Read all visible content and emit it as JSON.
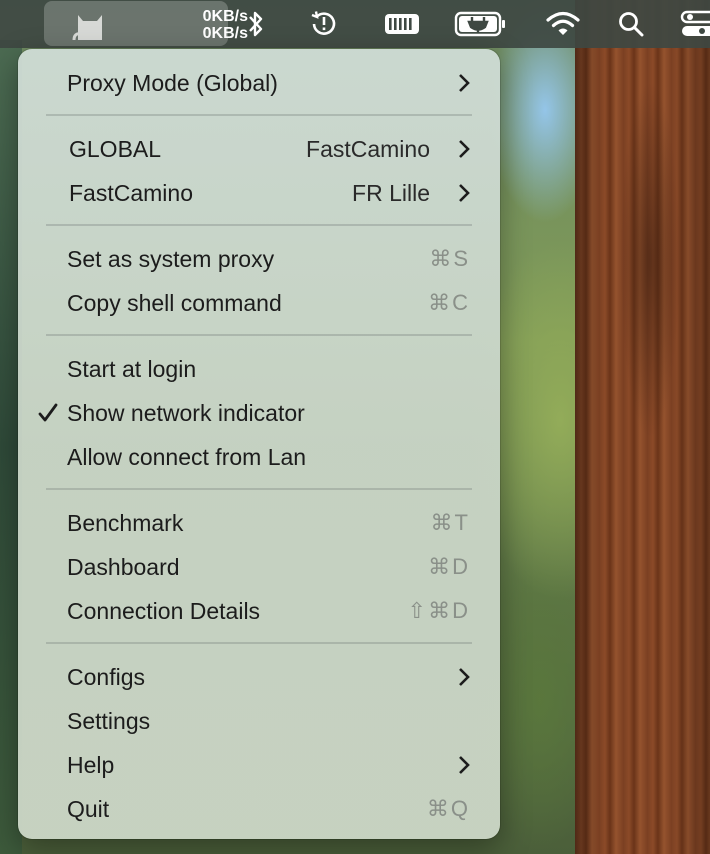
{
  "menubar": {
    "upload_speed": "0KB/s",
    "download_speed": "0KB/s",
    "icons": [
      "cat-app-icon",
      "bluetooth-icon",
      "time-machine-icon",
      "battery-charging-icon",
      "power-plug-icon",
      "wifi-icon",
      "search-icon",
      "control-center-icon"
    ]
  },
  "menu": {
    "proxy_mode": {
      "label": "Proxy Mode (Global)"
    },
    "global": {
      "label": "GLOBAL",
      "detail": "FastCamino"
    },
    "fastcamino": {
      "label": "FastCamino",
      "detail": "FR Lille"
    },
    "set_system_proxy": {
      "label": "Set as system proxy",
      "shortcut": "⌘S"
    },
    "copy_shell": {
      "label": "Copy shell command",
      "shortcut": "⌘C"
    },
    "start_login": {
      "label": "Start at login"
    },
    "show_network": {
      "label": "Show network indicator",
      "checked": true
    },
    "allow_lan": {
      "label": "Allow connect from Lan"
    },
    "benchmark": {
      "label": "Benchmark",
      "shortcut": "⌘T"
    },
    "dashboard": {
      "label": "Dashboard",
      "shortcut": "⌘D"
    },
    "connection_details": {
      "label": "Connection Details",
      "shortcut": "⇧⌘D"
    },
    "configs": {
      "label": "Configs"
    },
    "settings": {
      "label": "Settings"
    },
    "help": {
      "label": "Help"
    },
    "quit": {
      "label": "Quit",
      "shortcut": "⌘Q"
    }
  },
  "colors": {
    "menubar_bg": "#3e4842",
    "menu_bg": "#cedbd4",
    "text": "#1c1c1c",
    "shortcut_text": "#8a9089"
  }
}
